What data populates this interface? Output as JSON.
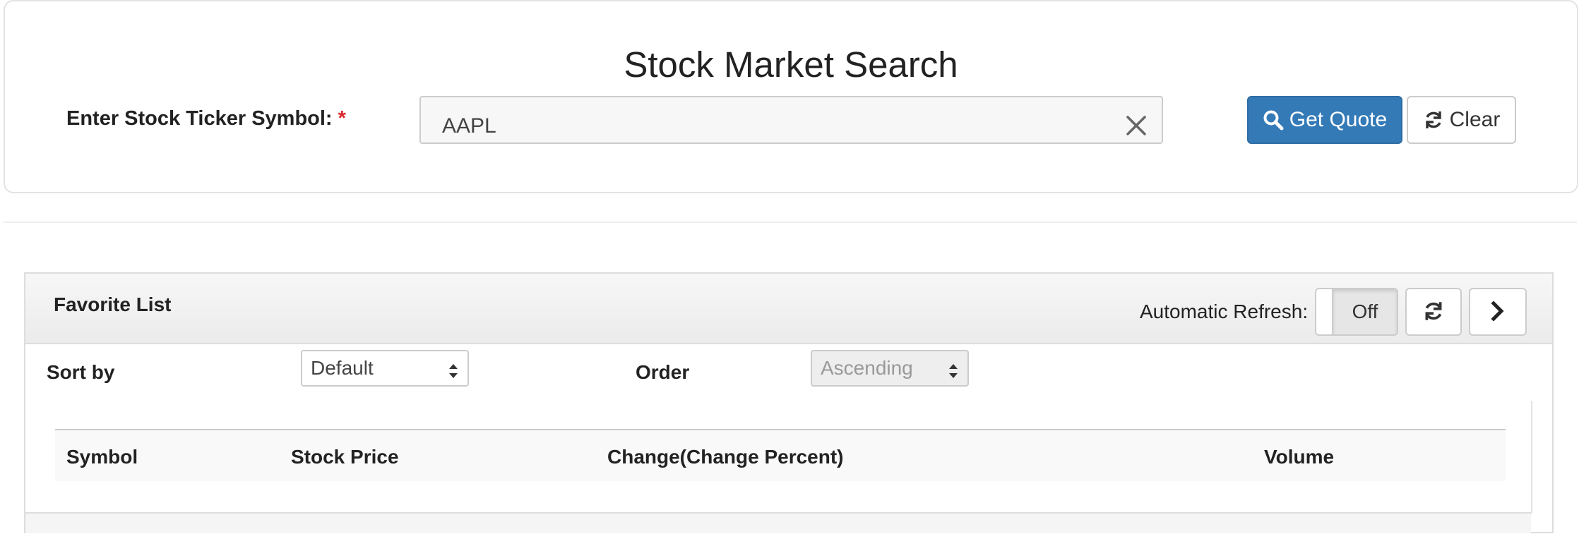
{
  "search": {
    "title": "Stock Market Search",
    "ticker_label": "Enter Stock Ticker Symbol: ",
    "required_mark": "*",
    "ticker_value": "AAPL",
    "get_quote_label": "Get Quote",
    "clear_label": "Clear"
  },
  "favorites": {
    "title": "Favorite List",
    "auto_refresh_label": "Automatic Refresh:",
    "auto_refresh_state": "Off",
    "sort_by_label": "Sort by",
    "sort_by_value": "Default",
    "order_label": "Order",
    "order_value": "Ascending",
    "columns": [
      "Symbol",
      "Stock Price",
      "Change(Change Percent)",
      "Volume"
    ]
  },
  "icons": {
    "search": "search-icon",
    "clear_input": "close-icon",
    "clear_button": "refresh-icon",
    "refresh": "refresh-icon",
    "next": "chevron-right-icon"
  },
  "colors": {
    "primary": "#337ab7",
    "required": "#d9262b"
  }
}
